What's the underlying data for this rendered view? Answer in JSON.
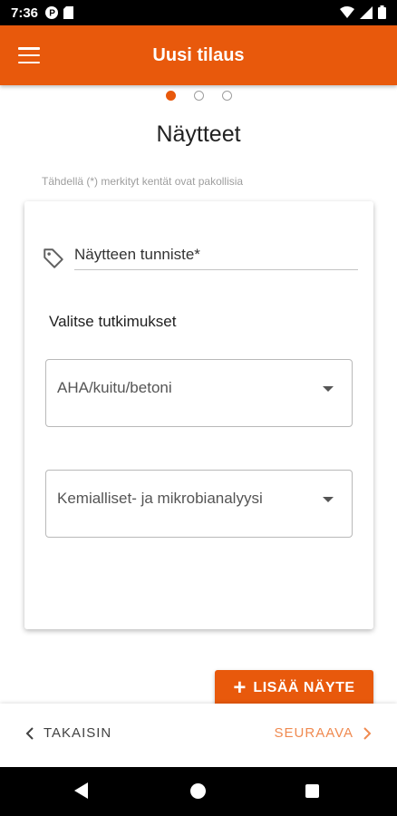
{
  "status_bar": {
    "time": "7:36",
    "icons": [
      "p-icon",
      "sd-card-icon",
      "wifi-icon",
      "signal-icon",
      "battery-icon"
    ]
  },
  "app_bar": {
    "title": "Uusi tilaus",
    "menu_icon": "hamburger-menu-icon"
  },
  "stepper": {
    "total_steps": 3,
    "current_step": 1
  },
  "page": {
    "title": "Näytteet",
    "required_note": "Tähdellä (*) merkityt kentät ovat pakollisia"
  },
  "form": {
    "sample_id_placeholder": "Näytteen tunniste*",
    "tag_icon": "tag-icon",
    "section_label": "Valitse tutkimukset",
    "select_1_value": "AHA/kuitu/betoni",
    "select_2_value": "Kemialliset- ja mikrobianalyysi"
  },
  "actions": {
    "add_sample": "LISÄÄ NÄYTE",
    "back": "TAKAISIN",
    "next": "SEURAAVA"
  },
  "colors": {
    "accent": "#e8590c",
    "next_text": "#f08a50"
  }
}
